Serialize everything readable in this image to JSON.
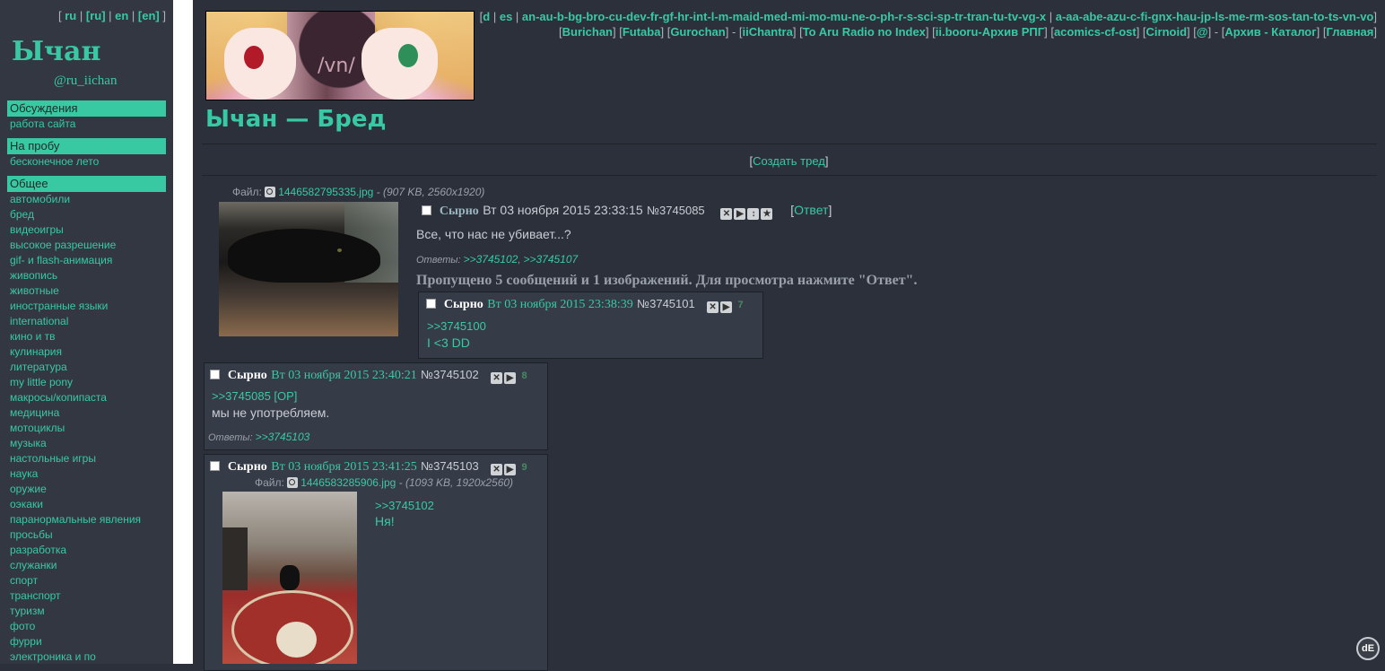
{
  "lang": {
    "items": [
      "ru",
      "[ru]",
      "en",
      "[en]"
    ]
  },
  "site": {
    "title": "Ычан",
    "handle": "@ru_iichan"
  },
  "sidebar": {
    "sections": [
      {
        "header": "Обсуждения",
        "items": [
          "работа сайта"
        ]
      },
      {
        "header": "На пробу",
        "items": [
          "бесконечное лето"
        ]
      },
      {
        "header": "Общее",
        "items": [
          "автомобили",
          "бред",
          "видеоигры",
          "высокое разрешение",
          "gif- и flash-анимация",
          "живопись",
          "животные",
          "иностранные языки",
          "international",
          "кино и тв",
          "кулинария",
          "литература",
          "my little pony",
          "макросы/копипаста",
          "медицина",
          "мотоциклы",
          "музыка",
          "настольные игры",
          "наука",
          "оружие",
          "оэкаки",
          "паранормальные явления",
          "просьбы",
          "разработка",
          "служанки",
          "спорт",
          "транспорт",
          "туризм",
          "фото",
          "фурри",
          "электроника и по"
        ]
      }
    ]
  },
  "boardnav": {
    "line1_pre": "[",
    "group1": "d",
    "sep1": " | ",
    "group2": "es",
    "sep2": " | ",
    "group3": "an-au-b-bg-bro-cu-dev-fr-gf-hr-int-l-m-maid-med-mi-mo-mu-ne-o-ph-r-s-sci-sp-tr-tran-tu-tv-vg-x",
    "sep3": " | ",
    "group4": "a-aa-abe-azu-c-fi-gnx-hau-jp-ls-me-rm-sos-tan-to-ts-vn-vo",
    "line1_post": "]",
    "line2": [
      "Burichan",
      "Futaba",
      "Gurochan",
      "iiChantra",
      "To Aru Radio no Index",
      "ii.booru-Архив РПГ",
      "acomics-cf-ost",
      "Cirnoid",
      "@",
      "Архив - Каталог",
      "Главная"
    ]
  },
  "board": {
    "title": "Ычан — Бред",
    "create_thread": "Создать тред"
  },
  "op": {
    "file_label": "Файл:",
    "file_name": "1446582795335.jpg",
    "file_info": "(907 KB, 2560x1920)",
    "poster": "Сырно",
    "date": "Вт 03 ноября 2015 23:33:15",
    "number": "№3745085",
    "reply_link": "Ответ",
    "text": "Все, что нас не убивает...?",
    "answers_label": "Ответы:",
    "answers": [
      ">>3745102",
      ">>3745107"
    ],
    "omitted": "Пропущено 5 сообщений и 1 изображений. Для просмотра нажмите \"Ответ\"."
  },
  "replies": [
    {
      "poster": "Сырно",
      "date": "Вт 03 ноября 2015 23:38:39",
      "number": "№3745101",
      "index": "7",
      "quote": ">>3745100",
      "text": "I <3 DD"
    },
    {
      "poster": "Сырно",
      "date": "Вт 03 ноября 2015 23:40:21",
      "number": "№3745102",
      "index": "8",
      "quote": ">>3745085 [OP]",
      "text": "мы не употребляем.",
      "answers_label": "Ответы:",
      "answers": [
        ">>3745103"
      ]
    },
    {
      "poster": "Сырно",
      "date": "Вт 03 ноября 2015 23:41:25",
      "number": "№3745103",
      "index": "9",
      "file_label": "Файл:",
      "file_name": "1446583285906.jpg",
      "file_info": "(1093 KB, 1920x2560)",
      "quote": ">>3745102",
      "text": "Ня!"
    }
  ],
  "colors": {
    "accent": "#39c9a2",
    "background": "#2b303a",
    "sidebar": "#323742",
    "reply_bg": "#353b47"
  }
}
